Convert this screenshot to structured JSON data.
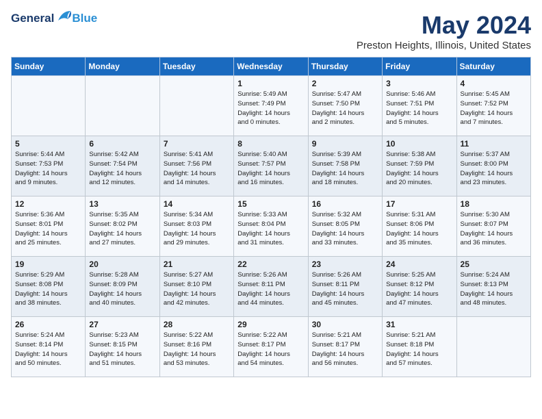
{
  "logo": {
    "general": "General",
    "blue": "Blue"
  },
  "title": "May 2024",
  "subtitle": "Preston Heights, Illinois, United States",
  "weekdays": [
    "Sunday",
    "Monday",
    "Tuesday",
    "Wednesday",
    "Thursday",
    "Friday",
    "Saturday"
  ],
  "weeks": [
    [
      {
        "num": "",
        "info": ""
      },
      {
        "num": "",
        "info": ""
      },
      {
        "num": "",
        "info": ""
      },
      {
        "num": "1",
        "info": "Sunrise: 5:49 AM\nSunset: 7:49 PM\nDaylight: 14 hours\nand 0 minutes."
      },
      {
        "num": "2",
        "info": "Sunrise: 5:47 AM\nSunset: 7:50 PM\nDaylight: 14 hours\nand 2 minutes."
      },
      {
        "num": "3",
        "info": "Sunrise: 5:46 AM\nSunset: 7:51 PM\nDaylight: 14 hours\nand 5 minutes."
      },
      {
        "num": "4",
        "info": "Sunrise: 5:45 AM\nSunset: 7:52 PM\nDaylight: 14 hours\nand 7 minutes."
      }
    ],
    [
      {
        "num": "5",
        "info": "Sunrise: 5:44 AM\nSunset: 7:53 PM\nDaylight: 14 hours\nand 9 minutes."
      },
      {
        "num": "6",
        "info": "Sunrise: 5:42 AM\nSunset: 7:54 PM\nDaylight: 14 hours\nand 12 minutes."
      },
      {
        "num": "7",
        "info": "Sunrise: 5:41 AM\nSunset: 7:56 PM\nDaylight: 14 hours\nand 14 minutes."
      },
      {
        "num": "8",
        "info": "Sunrise: 5:40 AM\nSunset: 7:57 PM\nDaylight: 14 hours\nand 16 minutes."
      },
      {
        "num": "9",
        "info": "Sunrise: 5:39 AM\nSunset: 7:58 PM\nDaylight: 14 hours\nand 18 minutes."
      },
      {
        "num": "10",
        "info": "Sunrise: 5:38 AM\nSunset: 7:59 PM\nDaylight: 14 hours\nand 20 minutes."
      },
      {
        "num": "11",
        "info": "Sunrise: 5:37 AM\nSunset: 8:00 PM\nDaylight: 14 hours\nand 23 minutes."
      }
    ],
    [
      {
        "num": "12",
        "info": "Sunrise: 5:36 AM\nSunset: 8:01 PM\nDaylight: 14 hours\nand 25 minutes."
      },
      {
        "num": "13",
        "info": "Sunrise: 5:35 AM\nSunset: 8:02 PM\nDaylight: 14 hours\nand 27 minutes."
      },
      {
        "num": "14",
        "info": "Sunrise: 5:34 AM\nSunset: 8:03 PM\nDaylight: 14 hours\nand 29 minutes."
      },
      {
        "num": "15",
        "info": "Sunrise: 5:33 AM\nSunset: 8:04 PM\nDaylight: 14 hours\nand 31 minutes."
      },
      {
        "num": "16",
        "info": "Sunrise: 5:32 AM\nSunset: 8:05 PM\nDaylight: 14 hours\nand 33 minutes."
      },
      {
        "num": "17",
        "info": "Sunrise: 5:31 AM\nSunset: 8:06 PM\nDaylight: 14 hours\nand 35 minutes."
      },
      {
        "num": "18",
        "info": "Sunrise: 5:30 AM\nSunset: 8:07 PM\nDaylight: 14 hours\nand 36 minutes."
      }
    ],
    [
      {
        "num": "19",
        "info": "Sunrise: 5:29 AM\nSunset: 8:08 PM\nDaylight: 14 hours\nand 38 minutes."
      },
      {
        "num": "20",
        "info": "Sunrise: 5:28 AM\nSunset: 8:09 PM\nDaylight: 14 hours\nand 40 minutes."
      },
      {
        "num": "21",
        "info": "Sunrise: 5:27 AM\nSunset: 8:10 PM\nDaylight: 14 hours\nand 42 minutes."
      },
      {
        "num": "22",
        "info": "Sunrise: 5:26 AM\nSunset: 8:11 PM\nDaylight: 14 hours\nand 44 minutes."
      },
      {
        "num": "23",
        "info": "Sunrise: 5:26 AM\nSunset: 8:11 PM\nDaylight: 14 hours\nand 45 minutes."
      },
      {
        "num": "24",
        "info": "Sunrise: 5:25 AM\nSunset: 8:12 PM\nDaylight: 14 hours\nand 47 minutes."
      },
      {
        "num": "25",
        "info": "Sunrise: 5:24 AM\nSunset: 8:13 PM\nDaylight: 14 hours\nand 48 minutes."
      }
    ],
    [
      {
        "num": "26",
        "info": "Sunrise: 5:24 AM\nSunset: 8:14 PM\nDaylight: 14 hours\nand 50 minutes."
      },
      {
        "num": "27",
        "info": "Sunrise: 5:23 AM\nSunset: 8:15 PM\nDaylight: 14 hours\nand 51 minutes."
      },
      {
        "num": "28",
        "info": "Sunrise: 5:22 AM\nSunset: 8:16 PM\nDaylight: 14 hours\nand 53 minutes."
      },
      {
        "num": "29",
        "info": "Sunrise: 5:22 AM\nSunset: 8:17 PM\nDaylight: 14 hours\nand 54 minutes."
      },
      {
        "num": "30",
        "info": "Sunrise: 5:21 AM\nSunset: 8:17 PM\nDaylight: 14 hours\nand 56 minutes."
      },
      {
        "num": "31",
        "info": "Sunrise: 5:21 AM\nSunset: 8:18 PM\nDaylight: 14 hours\nand 57 minutes."
      },
      {
        "num": "",
        "info": ""
      }
    ]
  ]
}
